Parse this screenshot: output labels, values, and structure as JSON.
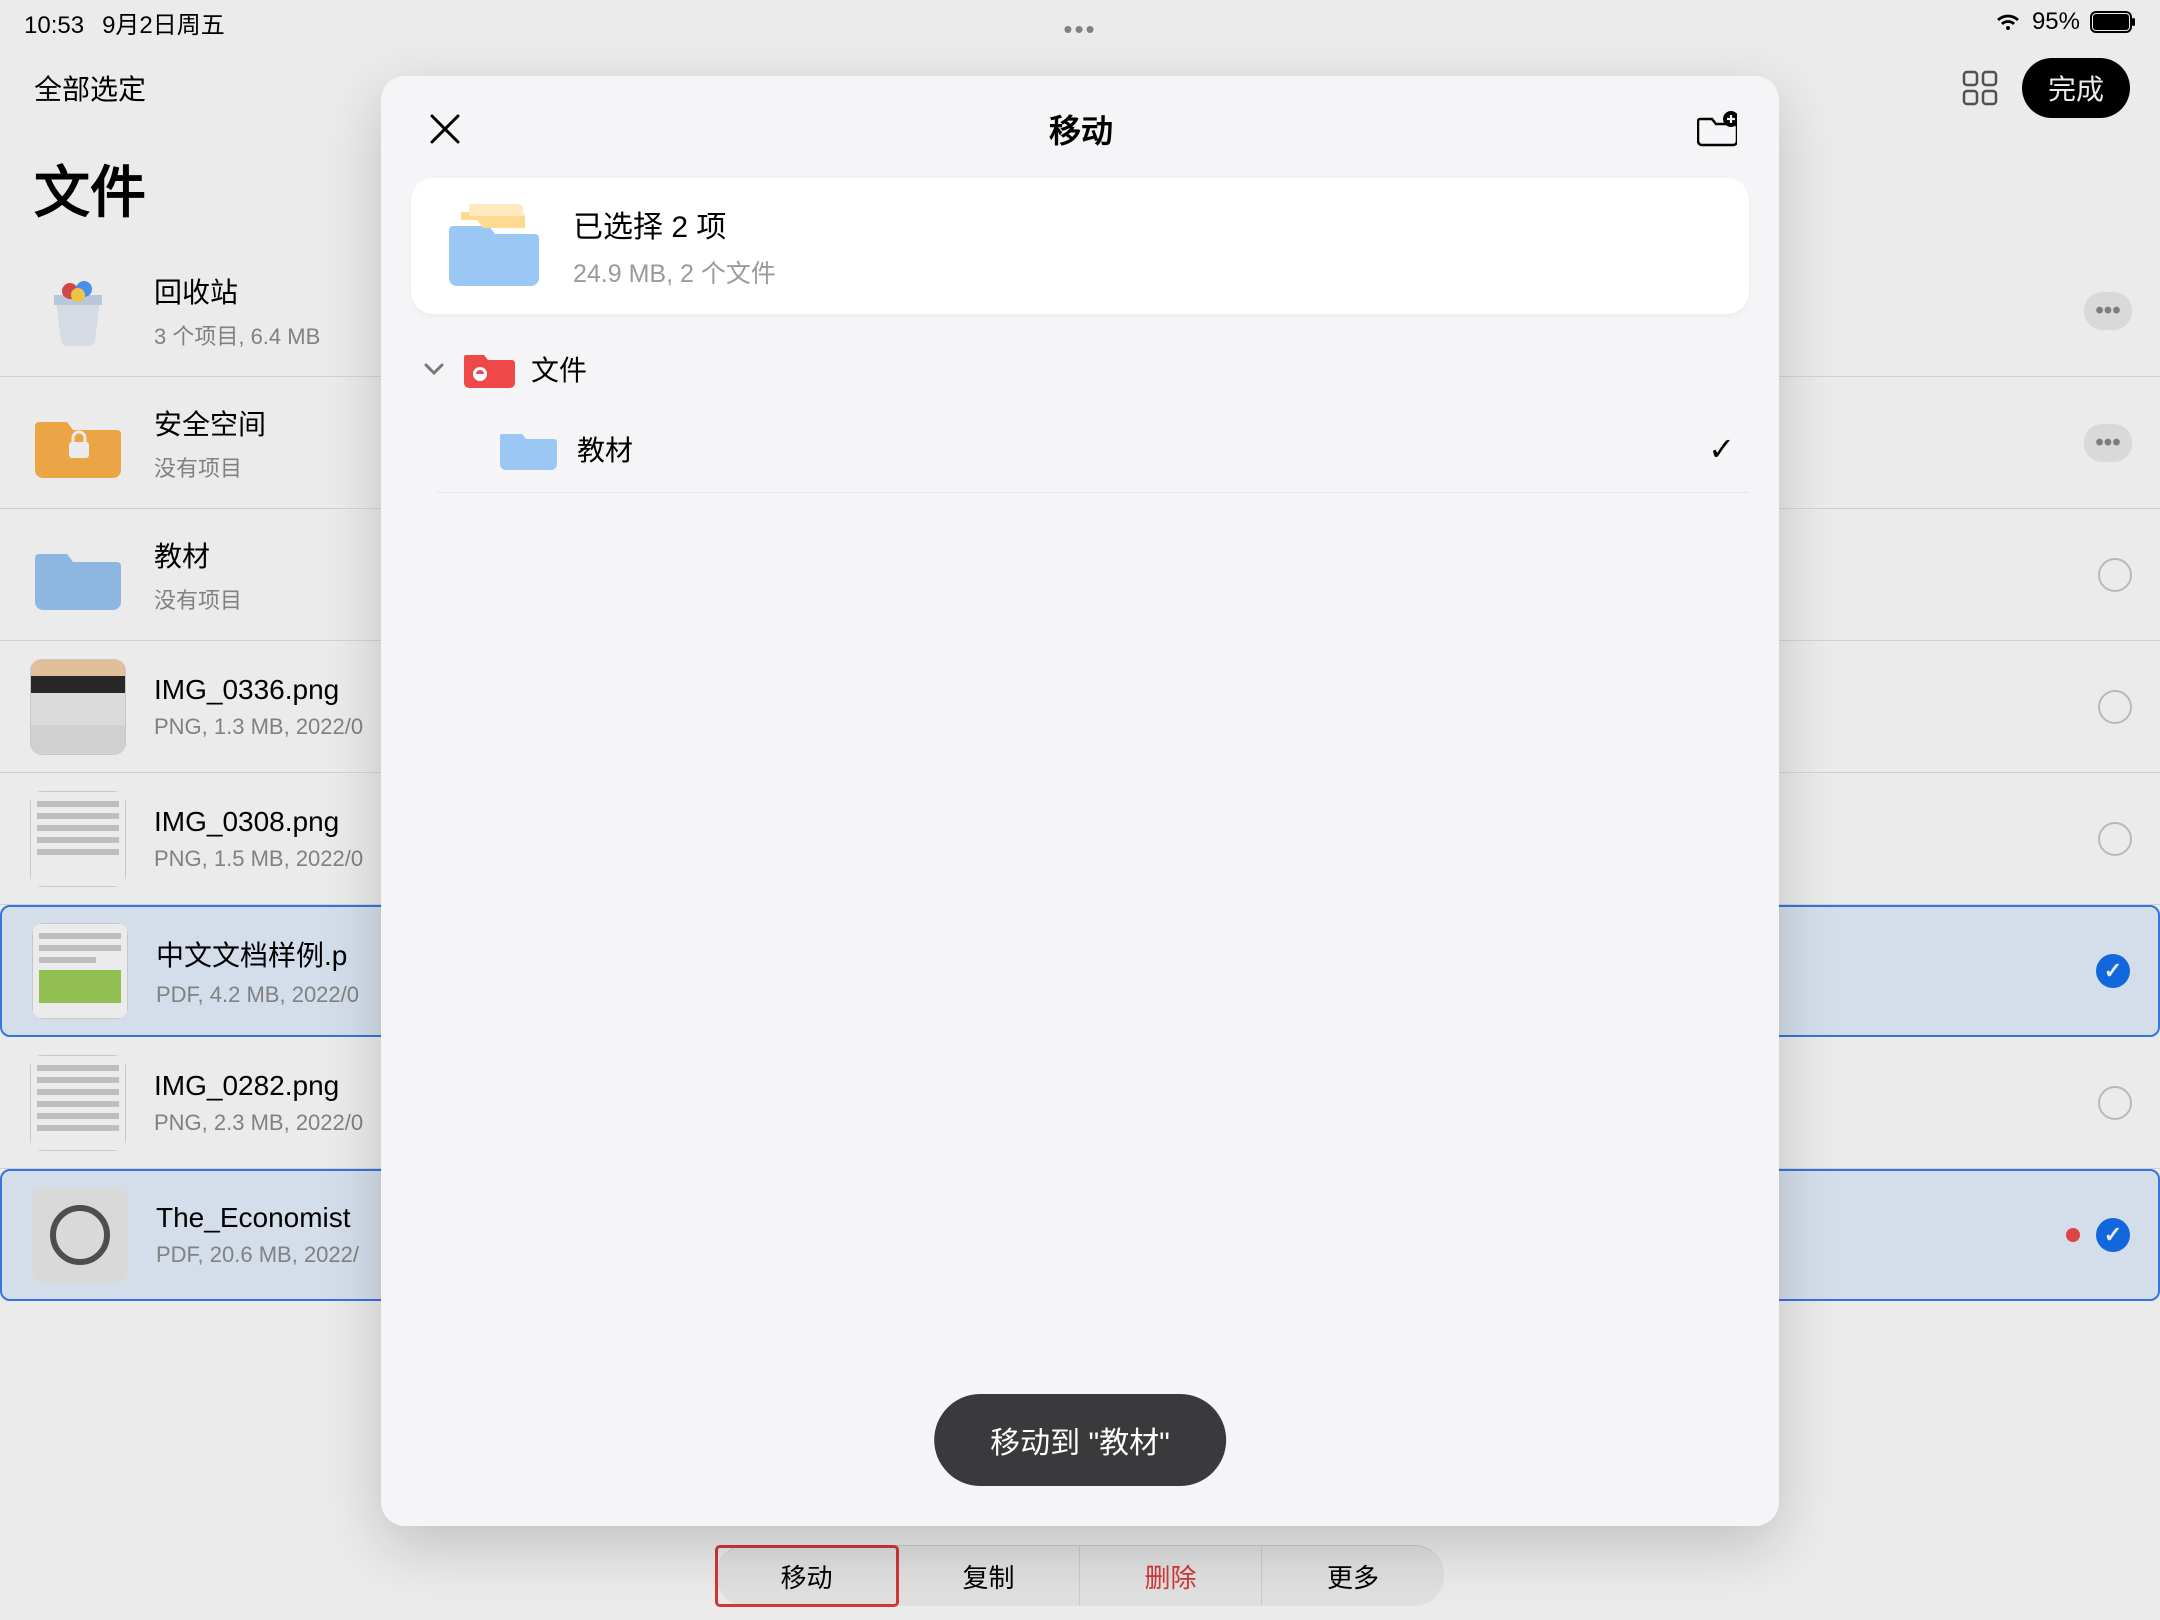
{
  "status": {
    "time": "10:53",
    "date": "9月2日周五",
    "battery": "95%"
  },
  "header": {
    "select_all": "全部选定",
    "title_cut": "",
    "done": "完成"
  },
  "page_title": "文件",
  "list": [
    {
      "name": "回收站",
      "meta": "3 个项目, 6.4 MB",
      "type": "trash",
      "has_more": true,
      "selectable": false
    },
    {
      "name": "安全空间",
      "meta": "没有项目",
      "type": "secure",
      "has_more": true,
      "selectable": false
    },
    {
      "name": "教材",
      "meta": "没有项目",
      "type": "folder",
      "selectable": true,
      "checked": false
    },
    {
      "name": "IMG_0336.png",
      "meta": "PNG, 1.3 MB, 2022/0",
      "type": "img",
      "selectable": true,
      "checked": false
    },
    {
      "name": "IMG_0308.png",
      "meta": "PNG, 1.5 MB, 2022/0",
      "type": "img",
      "selectable": true,
      "checked": false
    },
    {
      "name": "中文文档样例.p",
      "meta": "PDF, 4.2 MB, 2022/0",
      "type": "doc",
      "selectable": true,
      "checked": true,
      "selected_row": true
    },
    {
      "name": "IMG_0282.png",
      "meta": "PNG, 2.3 MB, 2022/0",
      "type": "img",
      "selectable": true,
      "checked": false
    },
    {
      "name": "The_Economist",
      "meta": "PDF, 20.6 MB, 2022/",
      "type": "watch",
      "selectable": true,
      "checked": true,
      "selected_row": true,
      "red_dot": true
    }
  ],
  "toolbar": {
    "move": "移动",
    "copy": "复制",
    "delete": "删除",
    "more": "更多"
  },
  "modal": {
    "title": "移动",
    "selection_title": "已选择 2 项",
    "selection_meta": "24.9 MB, 2 个文件",
    "root": "文件",
    "child": "教材",
    "move_button": "移动到 \"教材\""
  }
}
